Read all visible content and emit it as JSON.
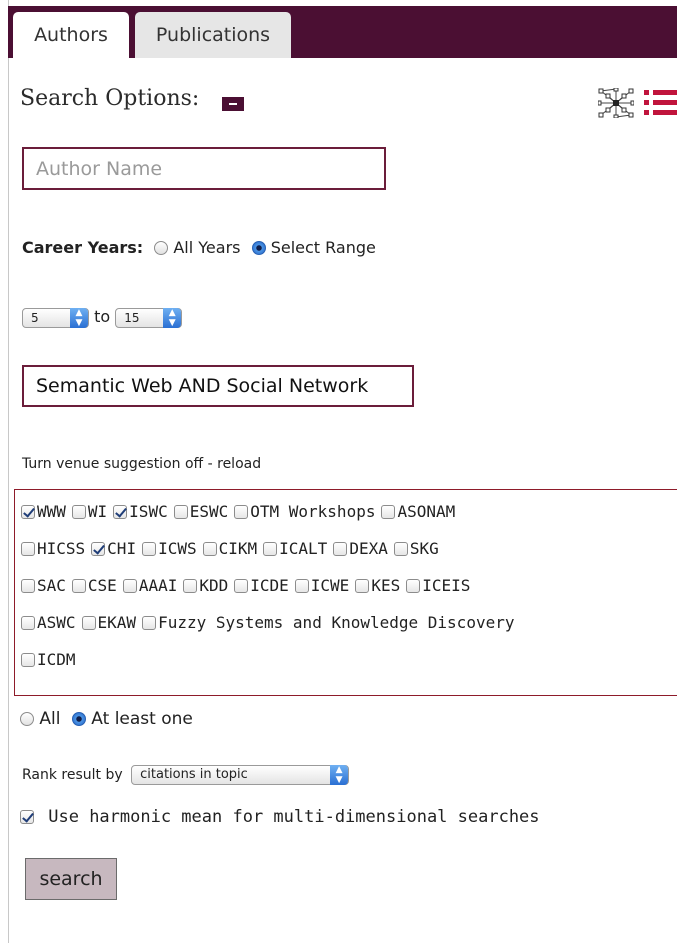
{
  "tabs": [
    {
      "label": "Authors",
      "active": true
    },
    {
      "label": "Publications",
      "active": false
    }
  ],
  "search_options": {
    "heading": "Search Options:",
    "author_placeholder": "Author Name"
  },
  "career_years": {
    "label": "Career Years:",
    "all_years": "All Years",
    "select_range": "Select Range",
    "selected": "Select Range",
    "from": "5",
    "to_label": "to",
    "to": "15"
  },
  "query": "Semantic Web AND Social Network",
  "venue_suggestion_link": "Turn venue suggestion off - reload",
  "venues": [
    [
      {
        "name": "WWW",
        "checked": true
      },
      {
        "name": "WI",
        "checked": false
      },
      {
        "name": "ISWC",
        "checked": true
      },
      {
        "name": "ESWC",
        "checked": false
      },
      {
        "name": "OTM Workshops",
        "checked": false
      },
      {
        "name": "ASONAM",
        "checked": false
      }
    ],
    [
      {
        "name": "HICSS",
        "checked": false
      },
      {
        "name": "CHI",
        "checked": true
      },
      {
        "name": "ICWS",
        "checked": false
      },
      {
        "name": "CIKM",
        "checked": false
      },
      {
        "name": "ICALT",
        "checked": false
      },
      {
        "name": "DEXA",
        "checked": false
      },
      {
        "name": "SKG",
        "checked": false
      }
    ],
    [
      {
        "name": "SAC",
        "checked": false
      },
      {
        "name": "CSE",
        "checked": false
      },
      {
        "name": "AAAI",
        "checked": false
      },
      {
        "name": "KDD",
        "checked": false
      },
      {
        "name": "ICDE",
        "checked": false
      },
      {
        "name": "ICWE",
        "checked": false
      },
      {
        "name": "KES",
        "checked": false
      },
      {
        "name": "ICEIS",
        "checked": false
      }
    ],
    [
      {
        "name": "ASWC",
        "checked": false
      },
      {
        "name": "EKAW",
        "checked": false
      },
      {
        "name": "Fuzzy Systems and Knowledge Discovery",
        "checked": false
      }
    ],
    [
      {
        "name": "ICDM",
        "checked": false
      }
    ]
  ],
  "venue_match": {
    "all": "All",
    "at_least_one": "At least one",
    "selected": "At least one"
  },
  "rank": {
    "label": "Rank result by",
    "selected": "citations in topic"
  },
  "harmonic": {
    "label": "Use harmonic mean for multi-dimensional searches",
    "checked": true
  },
  "search_button": "search",
  "colors": {
    "brand": "#4b0f33",
    "venue_border": "#8e1b2a",
    "selected_radio": "#2f71cd",
    "list_icon": "#c0143c"
  }
}
